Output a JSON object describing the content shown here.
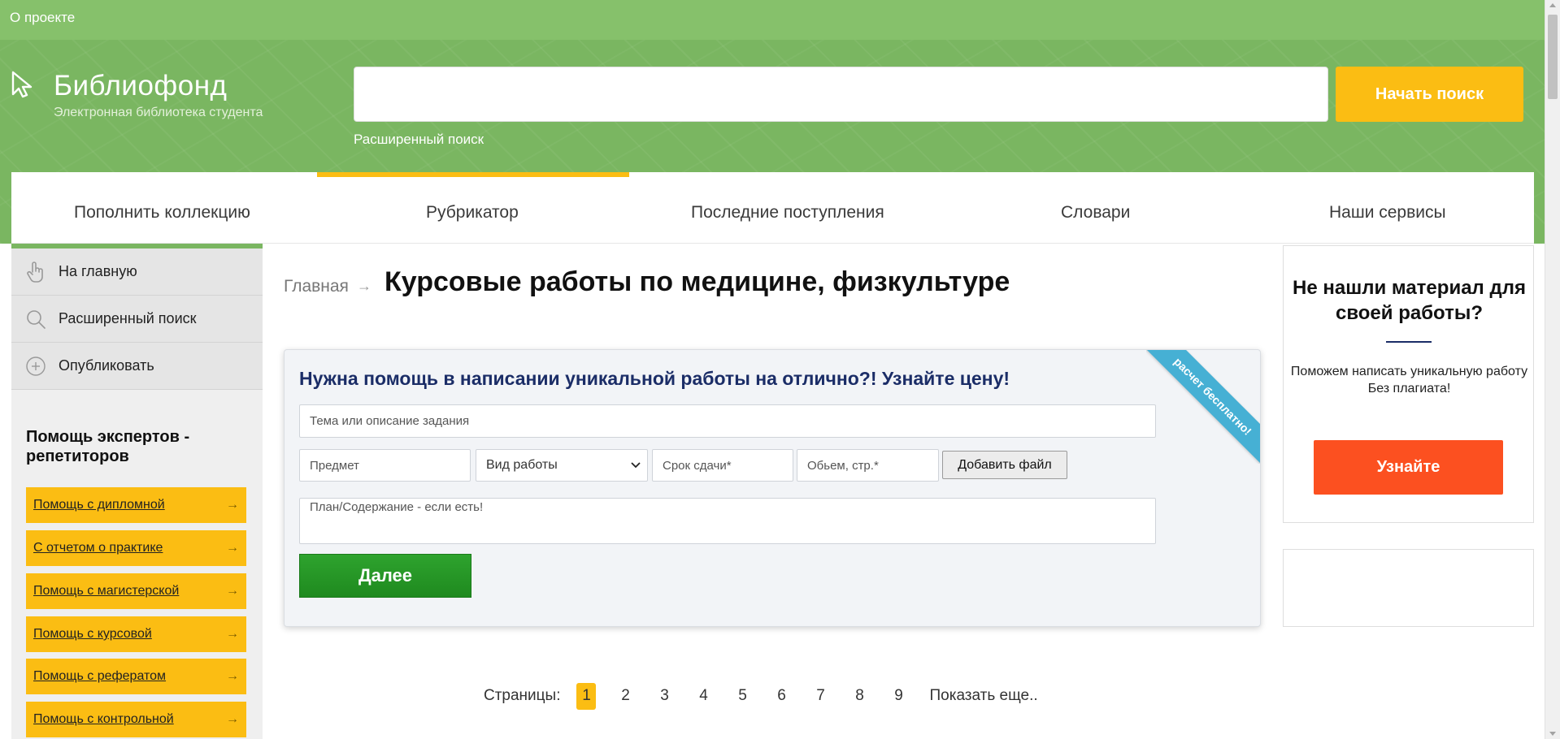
{
  "topbar": {
    "about_link": "О проекте"
  },
  "logo": {
    "title": "Библиофонд",
    "subtitle": "Электронная библиотека студента"
  },
  "search": {
    "value": "",
    "placeholder": "",
    "button_label": "Начать поиск",
    "advanced_link": "Расширенный поиск"
  },
  "nav": {
    "active_index": 1,
    "items": [
      {
        "label": "Пополнить коллекцию"
      },
      {
        "label": "Рубрикатор"
      },
      {
        "label": "Последние поступления"
      },
      {
        "label": "Словари"
      },
      {
        "label": "Наши сервисы"
      }
    ]
  },
  "sidebar": {
    "menu": [
      {
        "label": "На главную",
        "icon": "hand-pointer-icon"
      },
      {
        "label": "Расширенный поиск",
        "icon": "search-icon"
      },
      {
        "label": "Опубликовать",
        "icon": "plus-circle-icon"
      }
    ],
    "heading": "Помощь экспертов - репетиторов",
    "buttons": [
      {
        "label": "Помощь с дипломной"
      },
      {
        "label": "С отчетом о практике"
      },
      {
        "label": "Помощь с магистерской"
      },
      {
        "label": "Помощь с курсовой"
      },
      {
        "label": "Помощь с рефератом"
      },
      {
        "label": "Помощь с контрольной"
      }
    ]
  },
  "breadcrumb": {
    "home": "Главная",
    "separator": "→"
  },
  "page_title": "Курсовые работы по медицине, физкультуре",
  "order_form": {
    "heading": "Нужна помощь в написании уникальной работы на отлично?! Узнайте цену!",
    "ribbon": "расчет бесплатно!",
    "topic_placeholder": "Тема или описание задания",
    "subject_placeholder": "Предмет",
    "work_type_value": "Вид работы",
    "deadline_placeholder": "Срок сдачи*",
    "volume_placeholder": "Обьем, стр.*",
    "add_file_label": "Добавить файл",
    "plan_placeholder": "План/Содержание - если есть!",
    "next_label": "Далее"
  },
  "pagination": {
    "label": "Страницы:",
    "current": "1",
    "pages": [
      "1",
      "2",
      "3",
      "4",
      "5",
      "6",
      "7",
      "8",
      "9"
    ],
    "more": "Показать еще.."
  },
  "right_widget": {
    "title": "Не нашли материал для своей работы?",
    "text_line1": "Поможем написать уникальную работу",
    "text_line2": "Без плагиата!",
    "button_label": "Узнайте"
  },
  "colors": {
    "header_green": "#7ab661",
    "accent_yellow": "#fbbd13",
    "next_green": "#1f8a1f",
    "cta_orange": "#fc5020",
    "ribbon_blue": "#46b0d4",
    "heading_navy": "#1b2d67"
  }
}
